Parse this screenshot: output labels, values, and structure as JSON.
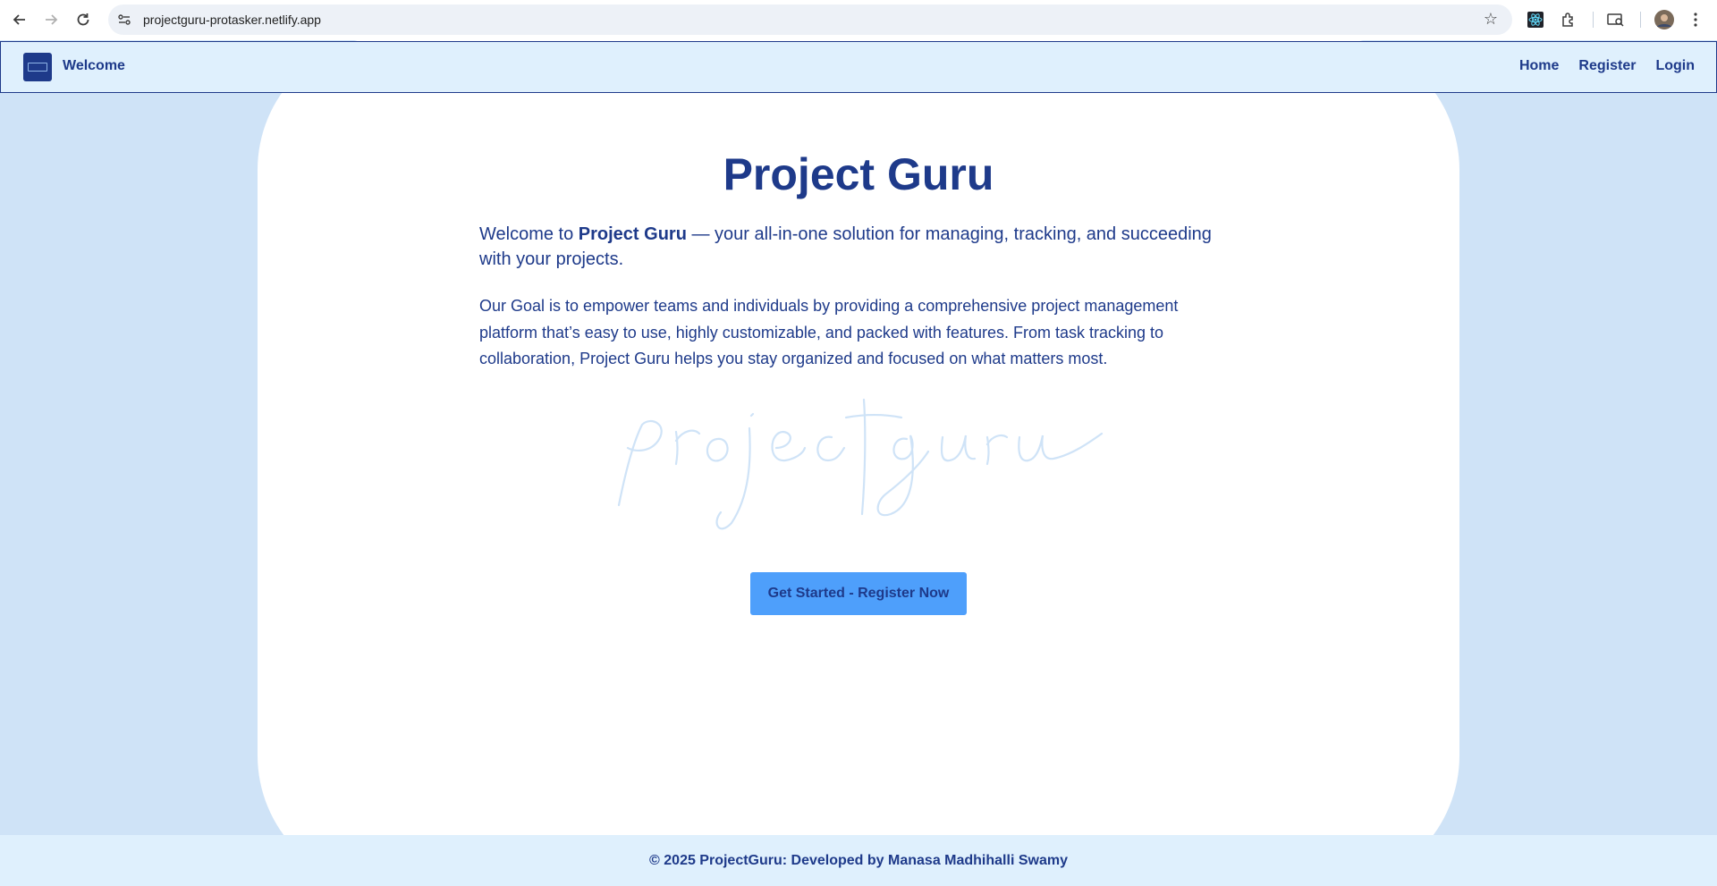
{
  "browser": {
    "url": "projectguru-protasker.netlify.app",
    "back_icon": "back-arrow-icon",
    "forward_icon": "forward-arrow-icon",
    "reload_icon": "reload-icon",
    "bookmark_icon": "star-icon"
  },
  "navbar": {
    "brand": "Welcome",
    "links": [
      "Home",
      "Register",
      "Login"
    ]
  },
  "hero": {
    "title": "Project Guru",
    "intro_prefix": "Welcome to ",
    "intro_brand": "Project Guru",
    "intro_suffix": " — your all-in-one solution for managing, tracking, and succeeding with your projects.",
    "goal": "Our Goal is to empower teams and individuals by providing a comprehensive project management platform that’s easy to use, highly customizable, and packed with features. From task tracking to collaboration, Project Guru helps you stay organized and focused on what matters most.",
    "watermark": "projectguru",
    "cta": "Get Started - Register Now"
  },
  "footer": {
    "text": "© 2025 ProjectGuru: Developed by Manasa Madhihalli Swamy"
  },
  "colors": {
    "primary": "#1e3a8a",
    "page_bg": "#cfe3f7",
    "nav_bg": "#dff0fd",
    "button": "#4e9ffb"
  }
}
